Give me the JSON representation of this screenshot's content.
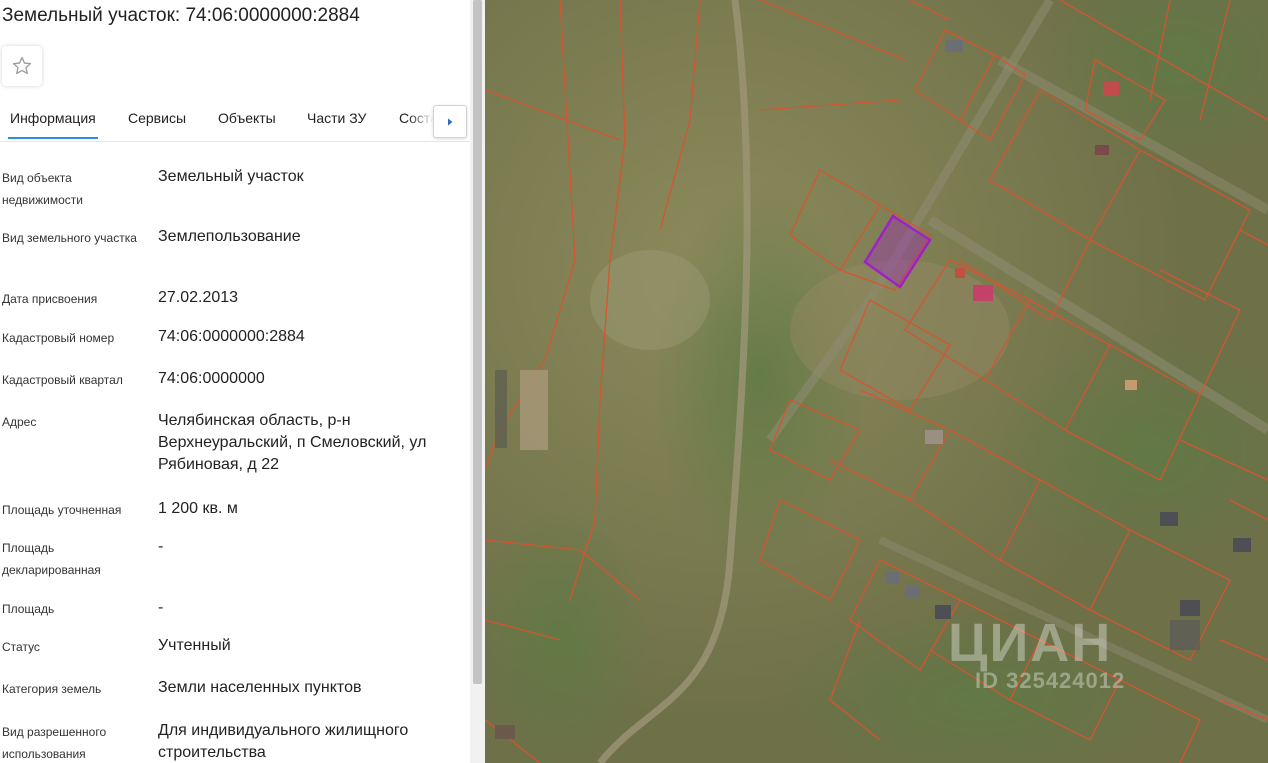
{
  "title": "Земельный участок: 74:06:0000000:2884",
  "tabs": [
    {
      "label": "Информация",
      "active": true
    },
    {
      "label": "Сервисы"
    },
    {
      "label": "Объекты"
    },
    {
      "label": "Части ЗУ"
    },
    {
      "label": "Состав"
    }
  ],
  "fields": [
    {
      "label": "Вид объекта недвижимости",
      "value": "Земельный участок"
    },
    {
      "label": "Вид земельного участка",
      "value": "Землепользование"
    },
    {
      "label": "Дата присвоения",
      "value": "27.02.2013"
    },
    {
      "label": "Кадастровый номер",
      "value": "74:06:0000000:2884"
    },
    {
      "label": "Кадастровый квартал",
      "value": "74:06:0000000"
    },
    {
      "label": "Адрес",
      "value": "Челябинская область, р-н Верхнеуральский, п Смеловский, ул Рябиновая, д 22"
    },
    {
      "label": "Площадь уточненная",
      "value": "1 200 кв. м"
    },
    {
      "label": "Площадь декларированная",
      "value": "-"
    },
    {
      "label": "Площадь",
      "value": "-"
    },
    {
      "label": "Статус",
      "value": "Учтенный"
    },
    {
      "label": "Категория земель",
      "value": "Земли населенных пунктов"
    },
    {
      "label": "Вид разрешенного использования",
      "value": "Для индивидуального жилищного строительства"
    }
  ],
  "map": {
    "watermark_logo": "ЦИАН",
    "watermark_id": "ID 325424012",
    "colors": {
      "parcel_border": "#e0502e",
      "selected_parcel": "#a020c8",
      "terrain": "#7b7a52"
    }
  }
}
